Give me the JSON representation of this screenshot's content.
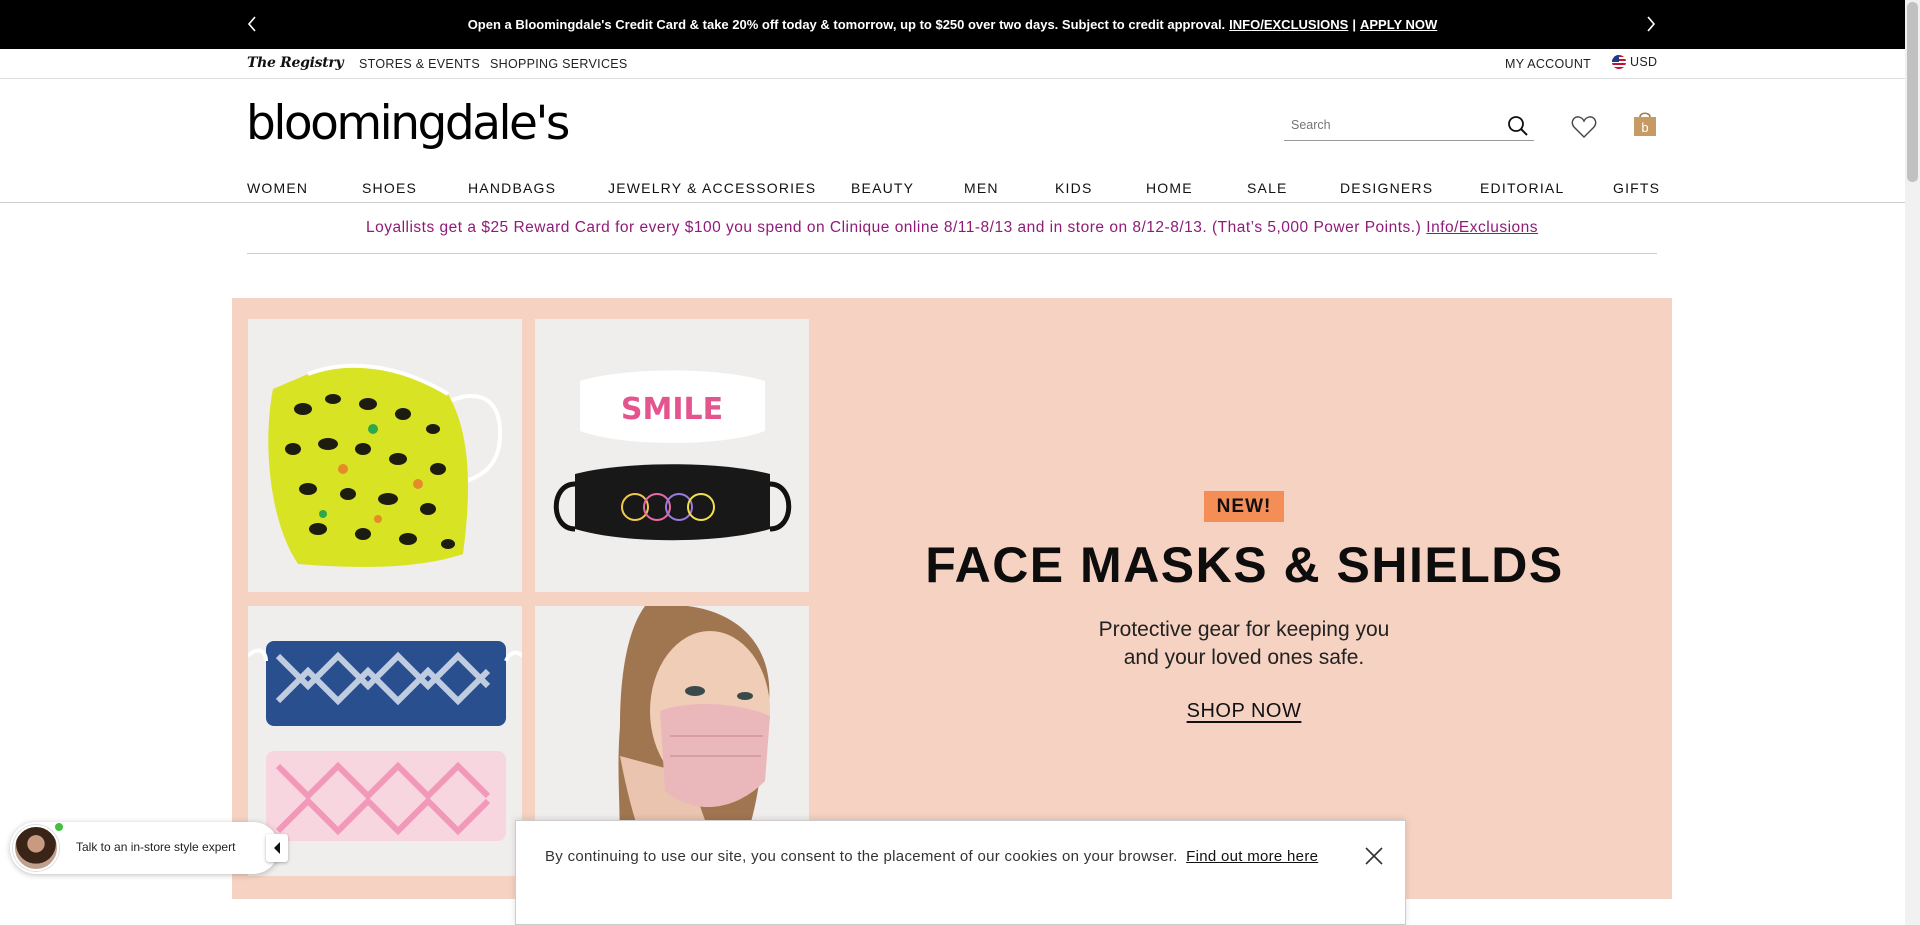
{
  "promo": {
    "text": "Open a Bloomingdale's Credit Card & take 20% off today & tomorrow, up to $250 over two days. Subject to credit approval.",
    "info_link": "INFO/EXCLUSIONS",
    "separator": "|",
    "apply_link": "APPLY NOW"
  },
  "util": {
    "registry": "The Registry",
    "stores": "STORES & EVENTS",
    "services": "SHOPPING SERVICES",
    "account": "MY ACCOUNT",
    "currency": "USD"
  },
  "header": {
    "logo": "bloomingdale's",
    "search_placeholder": "Search"
  },
  "nav": [
    "WOMEN",
    "SHOES",
    "HANDBAGS",
    "JEWELRY & ACCESSORIES",
    "BEAUTY",
    "MEN",
    "KIDS",
    "HOME",
    "SALE",
    "DESIGNERS",
    "EDITORIAL",
    "GIFTS"
  ],
  "loyal": {
    "text": "Loyallists get a $25 Reward Card for every $100 you spend on Clinique online 8/11-8/13 and in store on 8/12-8/13. (That’s 5,000 Power Points.)",
    "link": "Info/Exclusions"
  },
  "hero": {
    "badge": "NEW!",
    "headline": "FACE MASKS & SHIELDS",
    "subline": "Protective gear for keeping you and your loved ones safe.",
    "cta": "SHOP NOW",
    "tile2_text": "SMILE"
  },
  "chat": {
    "label": "Talk to an in-store style expert"
  },
  "cookie": {
    "message": "By continuing to use our site, you consent to the placement of our cookies on your browser.",
    "link": "Find out more here"
  },
  "colors": {
    "hero_bg": "#f5d2c2",
    "badge_bg": "#f58d57",
    "loyal_text": "#8f1b79"
  }
}
